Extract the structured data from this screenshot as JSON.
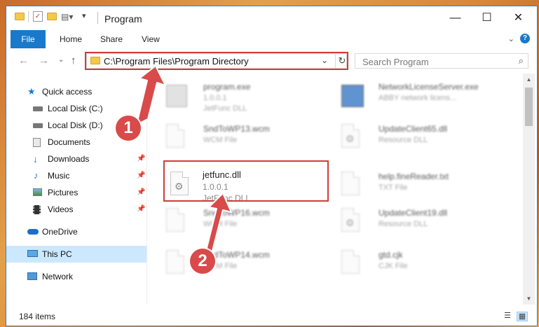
{
  "window": {
    "title": "Program",
    "controls": {
      "minimize": "—",
      "maximize": "☐",
      "close": "✕"
    }
  },
  "ribbon": {
    "tabs": [
      "File",
      "Home",
      "Share",
      "View"
    ],
    "help": "?"
  },
  "address_bar": {
    "path": "C:\\Program Files\\Program Directory"
  },
  "search": {
    "placeholder": "Search Program"
  },
  "sidebar": {
    "items": [
      {
        "label": "Quick access",
        "icon": "star-icon",
        "pinned": false
      },
      {
        "label": "Local Disk (C:)",
        "icon": "drive-icon",
        "pinned": false
      },
      {
        "label": "Local Disk (D:)",
        "icon": "drive-icon",
        "pinned": false
      },
      {
        "label": "Documents",
        "icon": "documents-icon",
        "pinned": false
      },
      {
        "label": "Downloads",
        "icon": "download-icon",
        "pinned": true
      },
      {
        "label": "Music",
        "icon": "music-icon",
        "pinned": true
      },
      {
        "label": "Pictures",
        "icon": "pictures-icon",
        "pinned": true
      },
      {
        "label": "Videos",
        "icon": "videos-icon",
        "pinned": true
      },
      {
        "label": "OneDrive",
        "icon": "cloud-icon",
        "pinned": false
      },
      {
        "label": "This PC",
        "icon": "computer-icon",
        "pinned": false,
        "selected": true
      },
      {
        "label": "Network",
        "icon": "network-icon",
        "pinned": false
      }
    ]
  },
  "files": [
    {
      "name": "program.exe",
      "line2": "1.0.0.1",
      "line3": "JetFunc DLL",
      "blurred": true
    },
    {
      "name": "NetworkLicenseServer.exe",
      "line2": "ABBY network licens...",
      "line3": "",
      "blurred": true
    },
    {
      "name": "SndToWP13.wcm",
      "line2": "WCM File",
      "line3": "",
      "blurred": true
    },
    {
      "name": "UpdateClient65.dll",
      "line2": "Resource DLL",
      "line3": "",
      "blurred": true
    },
    {
      "name": "jetfunc.dll",
      "line2": "1.0.0.1",
      "line3": "JetFunc DLL",
      "blurred": false
    },
    {
      "name": "help.fineReader.txt",
      "line2": "TXT File",
      "line3": "",
      "blurred": true
    },
    {
      "name": "SndToWP16.wcm",
      "line2": "WCM File",
      "line3": "",
      "blurred": true
    },
    {
      "name": "UpdateClient19.dll",
      "line2": "Resource DLL",
      "line3": "",
      "blurred": true
    },
    {
      "name": "SndToWP14.wcm",
      "line2": "WCM File",
      "line3": "",
      "blurred": true
    },
    {
      "name": "gtd.cjk",
      "line2": "CJK File",
      "line3": "",
      "blurred": true
    }
  ],
  "status": {
    "item_count": "184 items"
  },
  "annotations": {
    "badge1": "1",
    "badge2": "2",
    "color": "#d94a4a"
  }
}
